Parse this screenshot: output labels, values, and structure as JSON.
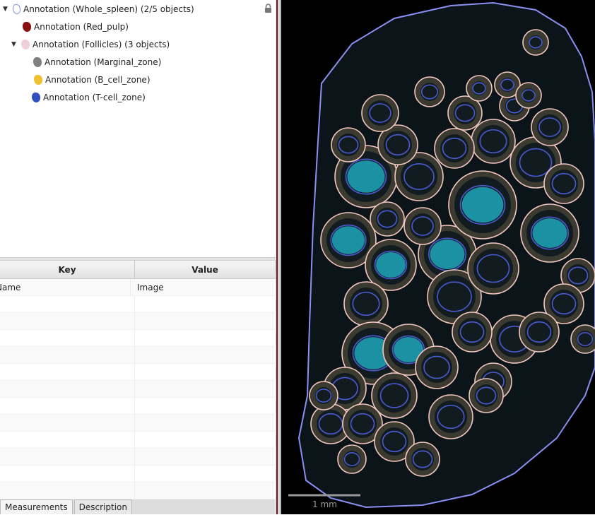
{
  "tree": {
    "items": [
      {
        "label": "Annotation (Whole_spleen) (2/5 objects)",
        "expanded": true,
        "icon": "outline-shape-icon",
        "color": "#8090e0"
      },
      {
        "label": "Annotation (Red_pulp)",
        "icon": "shape-icon",
        "color": "#8b1010"
      },
      {
        "label": "Annotation (Follicles) (3 objects)",
        "expanded": true,
        "icon": "shape-icon",
        "color": "#f0c8d0"
      },
      {
        "label": "Annotation (Marginal_zone)",
        "icon": "shape-icon",
        "color": "#808080"
      },
      {
        "label": "Annotation (B_cell_zone)",
        "icon": "shape-icon",
        "color": "#f0c030"
      },
      {
        "label": "Annotation (T-cell_zone)",
        "icon": "shape-icon",
        "color": "#3050c0"
      }
    ],
    "lock_icon": "lock-icon"
  },
  "table": {
    "headers": [
      "Key",
      "Value"
    ],
    "rows": [
      [
        "Name",
        "Image"
      ]
    ]
  },
  "tabs": [
    "Measurements",
    "Description"
  ],
  "viewer": {
    "scale_bar": "1 mm",
    "outline_color": "#8a8ff0",
    "follicle_color": "#f4c8c0",
    "tcell_color": "#4a5ad0",
    "bcell_color": "#20b8d0"
  }
}
